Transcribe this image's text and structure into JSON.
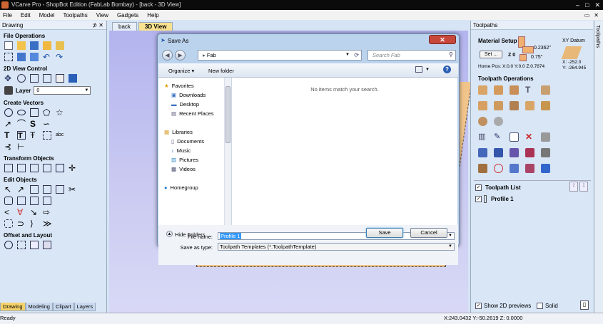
{
  "window": {
    "title": "VCarve Pro - ShopBot Edition (FabLab Bombay) - [back - 3D View]"
  },
  "menu": [
    "File",
    "Edit",
    "Model",
    "Toolpaths",
    "View",
    "Gadgets",
    "Help"
  ],
  "left_panel": {
    "title": "Drawing",
    "pin": "⊅ ✕",
    "sections": {
      "file_ops": "File Operations",
      "view_control": "2D View Control",
      "layer_label": "Layer",
      "layer_value": "0",
      "create_vectors": "Create Vectors",
      "transform": "Transform Objects",
      "edit": "Edit Objects",
      "offset": "Offset and Layout"
    },
    "tabs": [
      "Drawing",
      "Modeling",
      "Clipart",
      "Layers"
    ]
  },
  "view_tabs": [
    "back",
    "3D View"
  ],
  "right_panel": {
    "title": "Toolpaths",
    "strip_label": "Toolpaths",
    "material_setup": "Material Setup",
    "set_button": "Set ...",
    "thickness_top": "0.2362\"",
    "z_label": "Z 0",
    "thickness_bottom": "0.75\"",
    "home_pos": "Home Pos:  X:0.0 Y:0.0 Z:0.7874",
    "xy_datum": "XY Datum",
    "datum_x": "X: -252.0",
    "datum_y": "Y: -264.945",
    "ops_title": "Toolpath Operations",
    "toolpath_list": "Toolpath List",
    "profile": "Profile 1",
    "show_2d": "Show 2D previews",
    "solid": "Solid"
  },
  "dialog": {
    "title": "Save As",
    "address": "Fab",
    "search_placeholder": "Search Fab",
    "organize": "Organize ▾",
    "new_folder": "New folder",
    "nav": {
      "favorites": "Favorites",
      "downloads": "Downloads",
      "desktop": "Desktop",
      "recent": "Recent Places",
      "libraries": "Libraries",
      "documents": "Documents",
      "music": "Music",
      "pictures": "Pictures",
      "videos": "Videos",
      "homegroup": "Homegroup"
    },
    "empty_message": "No items match your search.",
    "file_name_label": "File name:",
    "file_name_value": "Profile 1",
    "save_type_label": "Save as type:",
    "save_type_value": "Toolpath Templates (*.ToolpathTemplate)",
    "hide_folders": "Hide Folders",
    "save": "Save",
    "cancel": "Cancel"
  },
  "status": {
    "left": "Ready",
    "coords": "X:243.0432 Y:-50.2619 Z: 0.0000"
  },
  "colors": {
    "accent": "#f6d36a",
    "wood": "#f0c48a",
    "close": "#c8473b"
  }
}
